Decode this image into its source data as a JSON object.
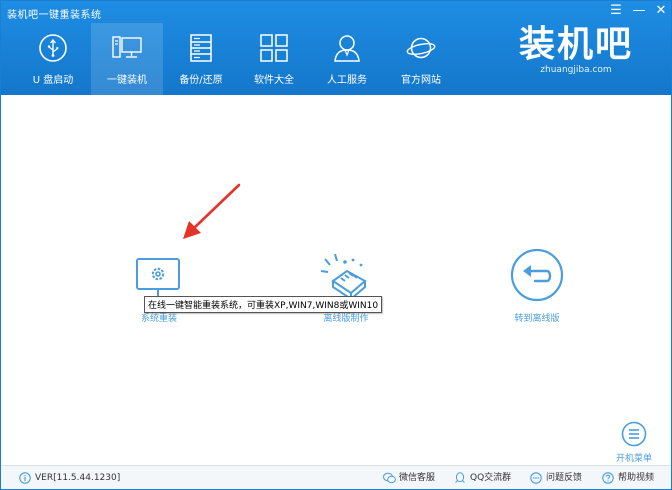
{
  "window": {
    "title": "装机吧一键重装系统",
    "menu_glyph": "☰",
    "min_glyph": "—",
    "close_glyph": "✕"
  },
  "nav": {
    "items": [
      {
        "label": "U 盘启动",
        "icon": "usb-icon"
      },
      {
        "label": "一键装机",
        "icon": "computer-icon",
        "active": true
      },
      {
        "label": "备份/还原",
        "icon": "backup-icon"
      },
      {
        "label": "软件大全",
        "icon": "apps-grid-icon"
      },
      {
        "label": "人工服务",
        "icon": "person-icon"
      },
      {
        "label": "官方网站",
        "icon": "planet-icon"
      }
    ]
  },
  "logo": {
    "text": "装机吧",
    "sub": "zhuangjiba.com"
  },
  "main": {
    "options": [
      {
        "label": "系统重装",
        "icon": "monitor-gear-icon"
      },
      {
        "label": "离线版制作",
        "icon": "offline-package-icon"
      },
      {
        "label": "转到离线版",
        "icon": "return-arrow-icon"
      }
    ],
    "tooltip": "在线一键智能重装系统，可重装XP,WIN7,WIN8或WIN10",
    "boot_menu": {
      "label": "开机菜单",
      "icon": "menu-list-icon"
    }
  },
  "footer": {
    "version": "VER[11.5.44.1230]",
    "links": [
      {
        "label": "微信客服",
        "icon": "wechat-icon"
      },
      {
        "label": "QQ交流群",
        "icon": "qq-icon"
      },
      {
        "label": "问题反馈",
        "icon": "chat-bubble-icon"
      },
      {
        "label": "帮助视频",
        "icon": "help-icon"
      }
    ]
  },
  "colors": {
    "header": "#1a84d8",
    "accent": "#4a9edd",
    "arrow": "#e5332a"
  }
}
